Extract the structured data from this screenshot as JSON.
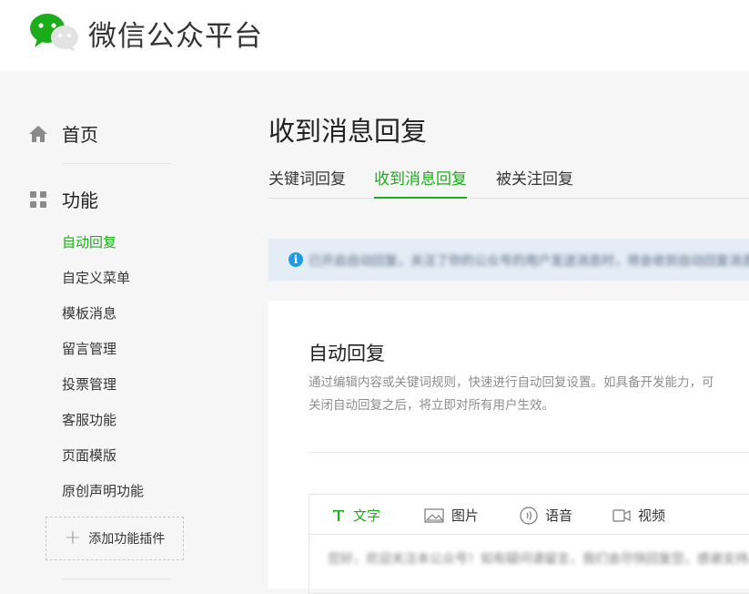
{
  "brand": {
    "title": "微信公众平台"
  },
  "sidebar": {
    "home_label": "首页",
    "features_label": "功能",
    "items": [
      {
        "label": "自动回复",
        "active": true
      },
      {
        "label": "自定义菜单"
      },
      {
        "label": "模板消息"
      },
      {
        "label": "留言管理"
      },
      {
        "label": "投票管理"
      },
      {
        "label": "客服功能"
      },
      {
        "label": "页面模版"
      },
      {
        "label": "原创声明功能"
      }
    ],
    "add_plugin_label": "添加功能插件"
  },
  "main": {
    "page_title": "收到消息回复",
    "tabs": [
      {
        "label": "关键词回复"
      },
      {
        "label": "收到消息回复",
        "active": true
      },
      {
        "label": "被关注回复"
      }
    ],
    "notice": {
      "icon": "info-icon",
      "text": "已开启自动回复，关注了你的公众号的用户发送消息时，将会收到自动回复消息。 更"
    },
    "card": {
      "title": "自动回复",
      "desc_line1": "通过编辑内容或关键词规则，快速进行自动回复设置。如具备开发能力，可",
      "desc_line2": "关闭自动回复之后，将立即对所有用户生效。",
      "editor_tabs": [
        {
          "label": "文字",
          "icon": "text-icon",
          "active": true
        },
        {
          "label": "图片",
          "icon": "image-icon"
        },
        {
          "label": "语音",
          "icon": "voice-icon"
        },
        {
          "label": "视频",
          "icon": "video-icon"
        }
      ],
      "editor_content": "您好，欢迎关注本公众号！如有疑问请留言，我们会尽快回复您，感谢支持。>"
    }
  },
  "colors": {
    "accent": "#1aad19",
    "notice_bg": "#e4ecf6",
    "info_blue": "#1e9be8"
  }
}
